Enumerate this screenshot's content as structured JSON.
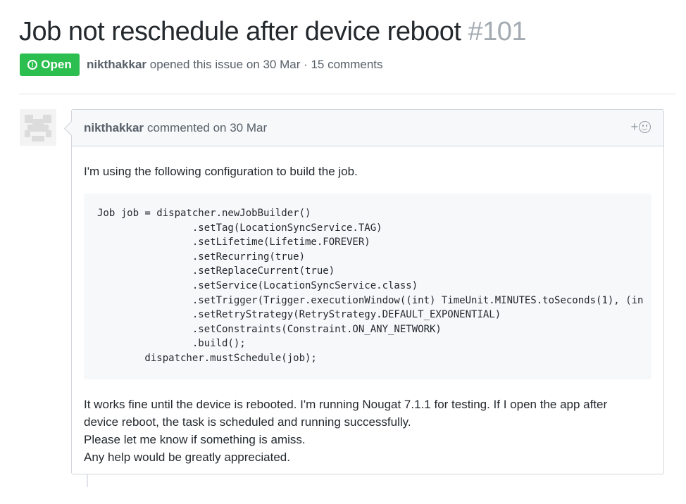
{
  "issue": {
    "title": "Job not reschedule after device reboot",
    "number": "#101",
    "state": "Open",
    "state_icon": "!",
    "author": "nikthakkar",
    "meta_text": "opened this issue on 30 Mar · 15 comments"
  },
  "comment": {
    "author": "nikthakkar",
    "action": "commented on 30 Mar",
    "reaction_plus": "+",
    "intro": "I'm using the following configuration to build the job.",
    "code": "Job job = dispatcher.newJobBuilder()\n                .setTag(LocationSyncService.TAG)\n                .setLifetime(Lifetime.FOREVER)\n                .setRecurring(true)\n                .setReplaceCurrent(true)\n                .setService(LocationSyncService.class)\n                .setTrigger(Trigger.executionWindow((int) TimeUnit.MINUTES.toSeconds(1), (in\n                .setRetryStrategy(RetryStrategy.DEFAULT_EXPONENTIAL)\n                .setConstraints(Constraint.ON_ANY_NETWORK)\n                .build();\n        dispatcher.mustSchedule(job);",
    "paragraphs": [
      "It works fine until the device is rebooted. I'm running Nougat 7.1.1 for testing. If I open the app after",
      "device reboot, the task is scheduled and running successfully.",
      "Please let me know if something is amiss.",
      "Any help would be greatly appreciated."
    ]
  }
}
